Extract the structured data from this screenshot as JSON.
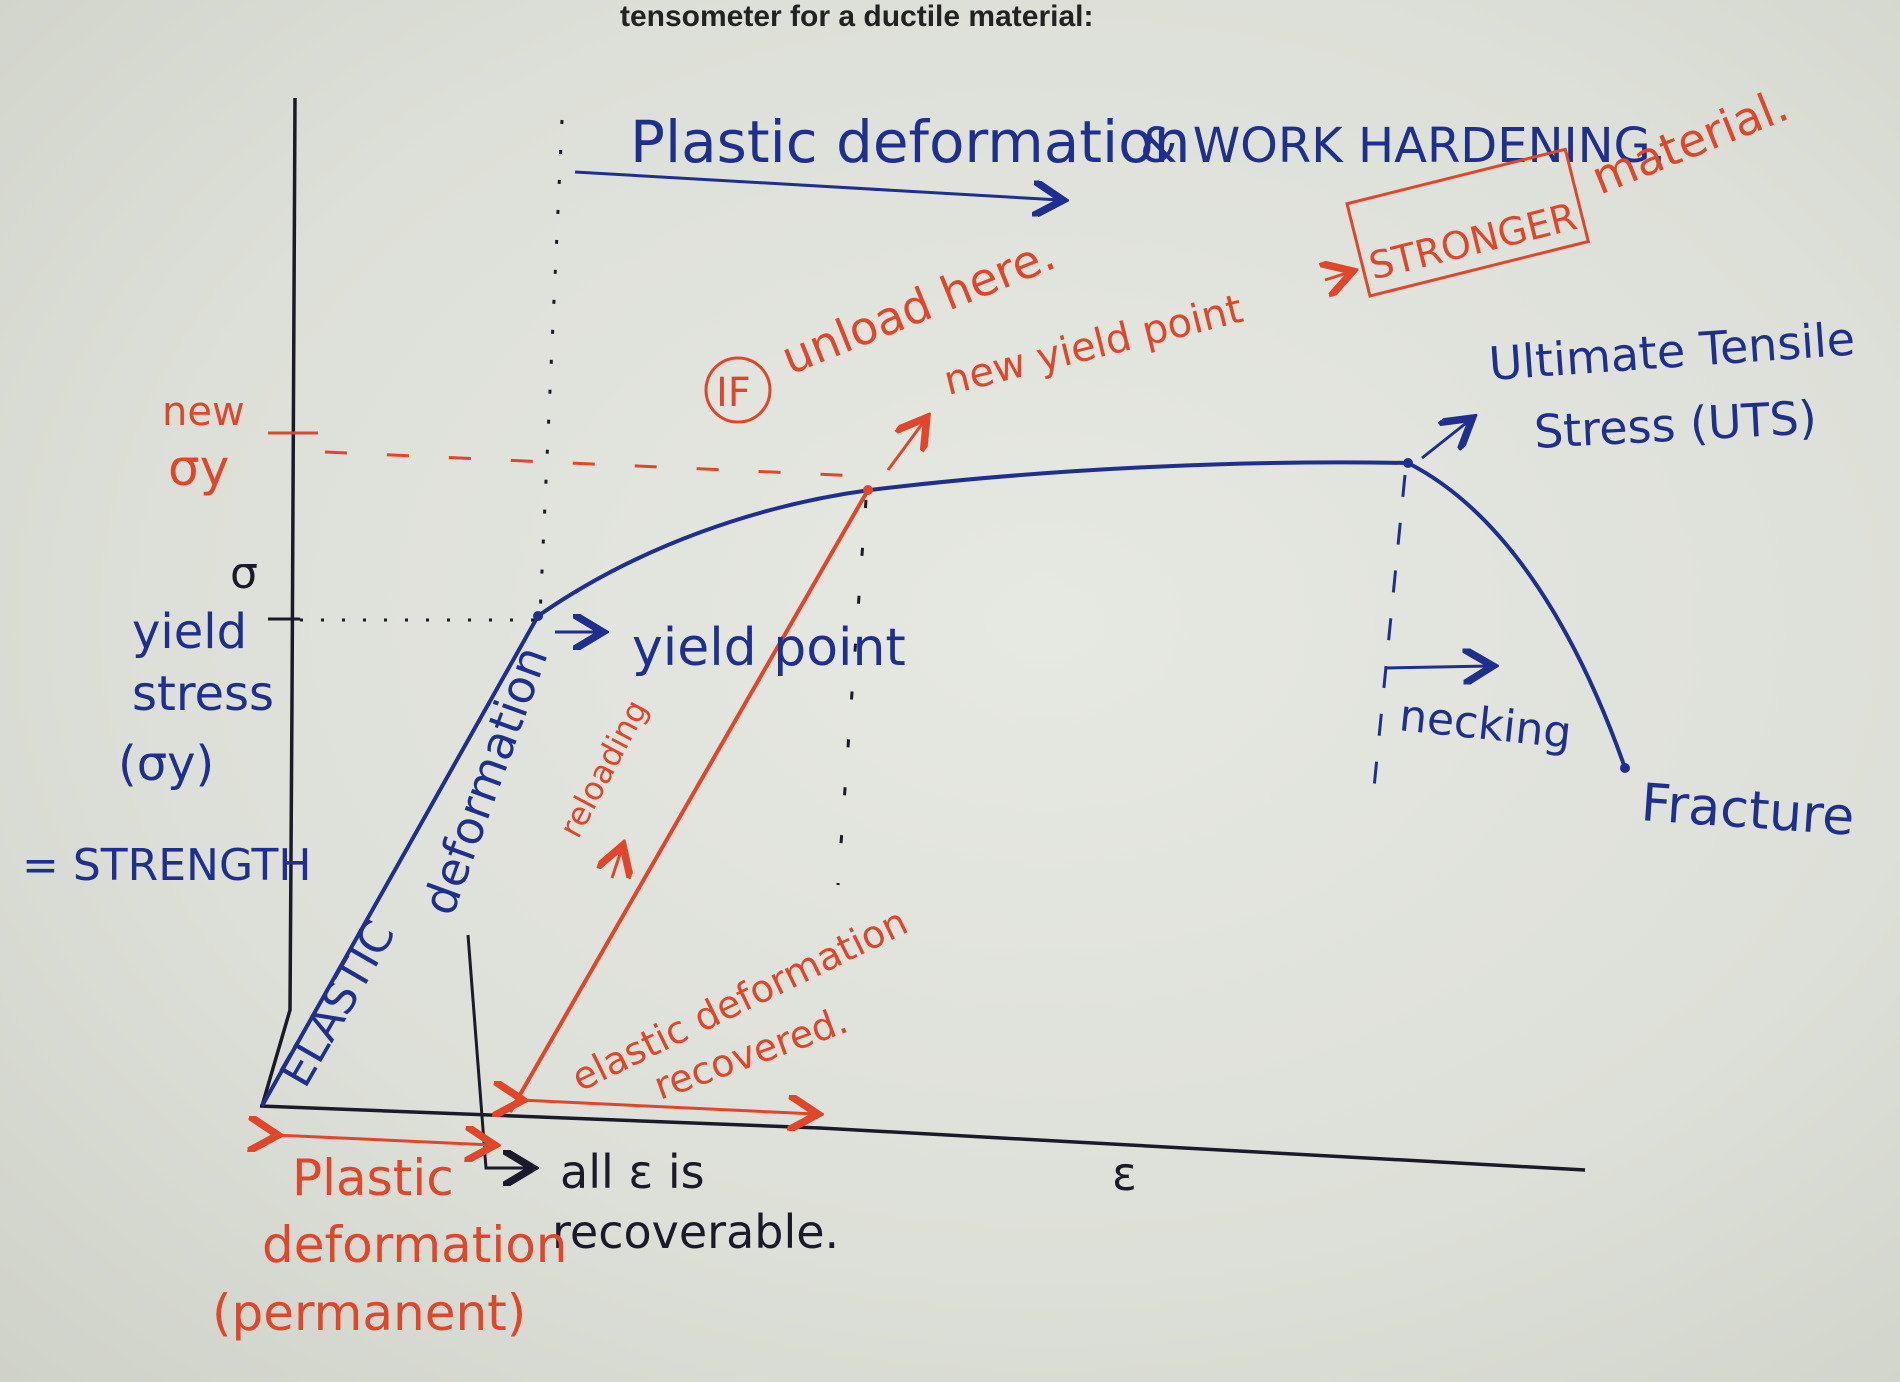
{
  "header": {
    "printed_text": "tensometer for a ductile material:"
  },
  "axes": {
    "x_symbol": "ε",
    "y_symbol": "σ"
  },
  "labels": {
    "plastic_title": "Plastic deformation",
    "work_hardening": "& WORK HARDENING.",
    "if_text": "IF",
    "unload_here": "unload here.",
    "new_yield_point": "new yield point",
    "stronger": "STRONGER",
    "material": "material.",
    "uts_line1": "Ultimate Tensile",
    "uts_line2": "Stress (UTS)",
    "new_sigma_y_1": "new",
    "new_sigma_y_2": "σy",
    "yield_stress_1": "yield",
    "yield_stress_2": "stress",
    "yield_stress_3": "(σy)",
    "strength": "= STRENGTH",
    "yield_point": "yield point",
    "elastic": "ELASTIC",
    "deformation_rot": "deformation",
    "reloading": "reloading",
    "necking": "necking",
    "fracture": "Fracture",
    "elastic_recovered_1": "elastic deformation",
    "elastic_recovered_2": "recovered.",
    "all_eps_1": "all ε is",
    "all_eps_2": "recoverable.",
    "plastic_perm_1": "Plastic",
    "plastic_perm_2": "deformation",
    "plastic_perm_3": "(permanent)"
  },
  "colors": {
    "blue_ink": "#1f2f8f",
    "red_ink": "#e2462a",
    "black_ink": "#1a1a2a"
  }
}
